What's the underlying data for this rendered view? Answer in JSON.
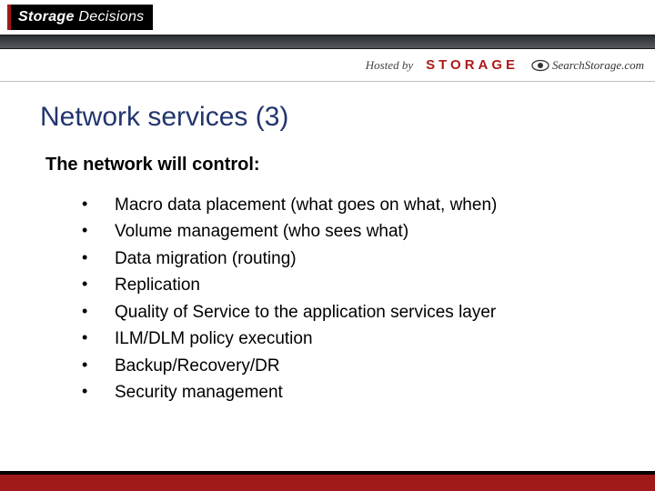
{
  "header": {
    "brand_word1": "Storage",
    "brand_word2": "Decisions",
    "hosted_by_label": "Hosted by",
    "logo_storage": "STORAGE",
    "logo_searchstorage": "SearchStorage.com"
  },
  "slide": {
    "title": "Network services (3)",
    "intro": "The network will control:",
    "bullets": [
      "Macro data placement (what goes on what, when)",
      "Volume management (who sees what)",
      "Data migration (routing)",
      "Replication",
      "Quality of Service to the application services layer",
      "ILM/DLM policy execution",
      "Backup/Recovery/DR",
      "Security management"
    ]
  }
}
